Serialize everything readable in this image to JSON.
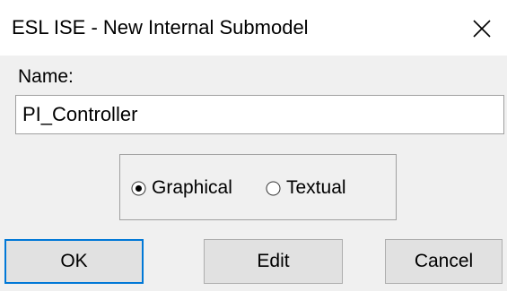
{
  "window": {
    "title": "ESL ISE - New Internal Submodel",
    "close_icon": "close-icon"
  },
  "name": {
    "label": "Name:",
    "value": "PI_Controller"
  },
  "mode": {
    "options": [
      {
        "label": "Graphical",
        "selected": true
      },
      {
        "label": "Textual",
        "selected": false
      }
    ]
  },
  "buttons": {
    "ok": "OK",
    "edit": "Edit",
    "cancel": "Cancel"
  },
  "colors": {
    "titlebar_bg": "#ffffff",
    "dialog_bg": "#f0f0f0",
    "default_button_border": "#0078d7"
  }
}
